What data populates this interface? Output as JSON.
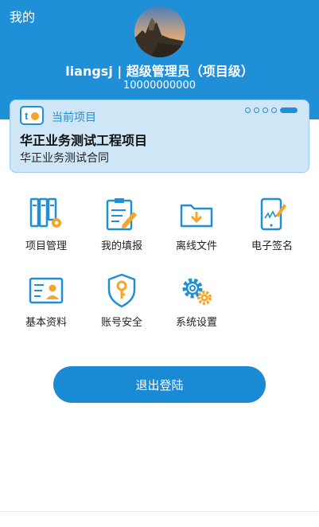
{
  "header": {
    "title": "我的",
    "username_line": "liangsj | 超级管理员（项目级）",
    "phone": "10000000000"
  },
  "project_card": {
    "label": "当前项目",
    "project_name": "华正业务测试工程项目",
    "contract_name": "华正业务测试合同",
    "slide_count": 5,
    "active_slide": 5
  },
  "menu": [
    {
      "label": "项目管理",
      "icon": "binders-gear-icon"
    },
    {
      "label": "我的填报",
      "icon": "document-edit-icon"
    },
    {
      "label": "离线文件",
      "icon": "folder-download-icon"
    },
    {
      "label": "电子签名",
      "icon": "tablet-signature-icon"
    },
    {
      "label": "基本资料",
      "icon": "profile-card-icon"
    },
    {
      "label": "账号安全",
      "icon": "shield-key-icon"
    },
    {
      "label": "系统设置",
      "icon": "gears-icon"
    }
  ],
  "logout_label": "退出登陆",
  "colors": {
    "primary": "#1f8fd8",
    "accent": "#f4a52a",
    "card_bg": "#cfe6f7"
  }
}
